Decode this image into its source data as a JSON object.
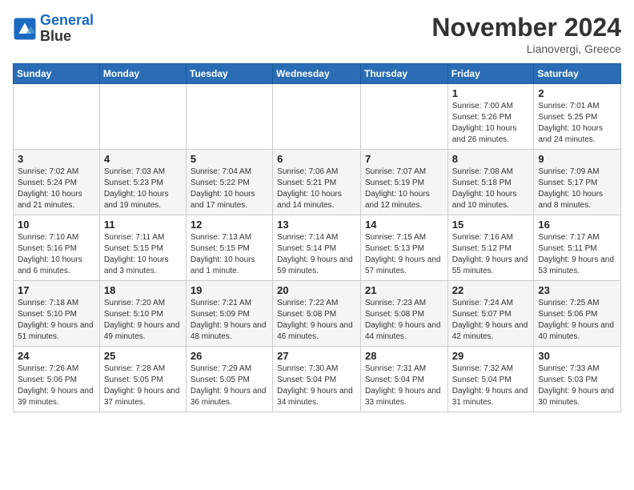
{
  "logo": {
    "line1": "General",
    "line2": "Blue"
  },
  "title": "November 2024",
  "location": "Lianovergi, Greece",
  "weekdays": [
    "Sunday",
    "Monday",
    "Tuesday",
    "Wednesday",
    "Thursday",
    "Friday",
    "Saturday"
  ],
  "weeks": [
    [
      {
        "day": "",
        "info": ""
      },
      {
        "day": "",
        "info": ""
      },
      {
        "day": "",
        "info": ""
      },
      {
        "day": "",
        "info": ""
      },
      {
        "day": "",
        "info": ""
      },
      {
        "day": "1",
        "info": "Sunrise: 7:00 AM\nSunset: 5:26 PM\nDaylight: 10 hours and 26 minutes."
      },
      {
        "day": "2",
        "info": "Sunrise: 7:01 AM\nSunset: 5:25 PM\nDaylight: 10 hours and 24 minutes."
      }
    ],
    [
      {
        "day": "3",
        "info": "Sunrise: 7:02 AM\nSunset: 5:24 PM\nDaylight: 10 hours and 21 minutes."
      },
      {
        "day": "4",
        "info": "Sunrise: 7:03 AM\nSunset: 5:23 PM\nDaylight: 10 hours and 19 minutes."
      },
      {
        "day": "5",
        "info": "Sunrise: 7:04 AM\nSunset: 5:22 PM\nDaylight: 10 hours and 17 minutes."
      },
      {
        "day": "6",
        "info": "Sunrise: 7:06 AM\nSunset: 5:21 PM\nDaylight: 10 hours and 14 minutes."
      },
      {
        "day": "7",
        "info": "Sunrise: 7:07 AM\nSunset: 5:19 PM\nDaylight: 10 hours and 12 minutes."
      },
      {
        "day": "8",
        "info": "Sunrise: 7:08 AM\nSunset: 5:18 PM\nDaylight: 10 hours and 10 minutes."
      },
      {
        "day": "9",
        "info": "Sunrise: 7:09 AM\nSunset: 5:17 PM\nDaylight: 10 hours and 8 minutes."
      }
    ],
    [
      {
        "day": "10",
        "info": "Sunrise: 7:10 AM\nSunset: 5:16 PM\nDaylight: 10 hours and 6 minutes."
      },
      {
        "day": "11",
        "info": "Sunrise: 7:11 AM\nSunset: 5:15 PM\nDaylight: 10 hours and 3 minutes."
      },
      {
        "day": "12",
        "info": "Sunrise: 7:13 AM\nSunset: 5:15 PM\nDaylight: 10 hours and 1 minute."
      },
      {
        "day": "13",
        "info": "Sunrise: 7:14 AM\nSunset: 5:14 PM\nDaylight: 9 hours and 59 minutes."
      },
      {
        "day": "14",
        "info": "Sunrise: 7:15 AM\nSunset: 5:13 PM\nDaylight: 9 hours and 57 minutes."
      },
      {
        "day": "15",
        "info": "Sunrise: 7:16 AM\nSunset: 5:12 PM\nDaylight: 9 hours and 55 minutes."
      },
      {
        "day": "16",
        "info": "Sunrise: 7:17 AM\nSunset: 5:11 PM\nDaylight: 9 hours and 53 minutes."
      }
    ],
    [
      {
        "day": "17",
        "info": "Sunrise: 7:18 AM\nSunset: 5:10 PM\nDaylight: 9 hours and 51 minutes."
      },
      {
        "day": "18",
        "info": "Sunrise: 7:20 AM\nSunset: 5:10 PM\nDaylight: 9 hours and 49 minutes."
      },
      {
        "day": "19",
        "info": "Sunrise: 7:21 AM\nSunset: 5:09 PM\nDaylight: 9 hours and 48 minutes."
      },
      {
        "day": "20",
        "info": "Sunrise: 7:22 AM\nSunset: 5:08 PM\nDaylight: 9 hours and 46 minutes."
      },
      {
        "day": "21",
        "info": "Sunrise: 7:23 AM\nSunset: 5:08 PM\nDaylight: 9 hours and 44 minutes."
      },
      {
        "day": "22",
        "info": "Sunrise: 7:24 AM\nSunset: 5:07 PM\nDaylight: 9 hours and 42 minutes."
      },
      {
        "day": "23",
        "info": "Sunrise: 7:25 AM\nSunset: 5:06 PM\nDaylight: 9 hours and 40 minutes."
      }
    ],
    [
      {
        "day": "24",
        "info": "Sunrise: 7:26 AM\nSunset: 5:06 PM\nDaylight: 9 hours and 39 minutes."
      },
      {
        "day": "25",
        "info": "Sunrise: 7:28 AM\nSunset: 5:05 PM\nDaylight: 9 hours and 37 minutes."
      },
      {
        "day": "26",
        "info": "Sunrise: 7:29 AM\nSunset: 5:05 PM\nDaylight: 9 hours and 36 minutes."
      },
      {
        "day": "27",
        "info": "Sunrise: 7:30 AM\nSunset: 5:04 PM\nDaylight: 9 hours and 34 minutes."
      },
      {
        "day": "28",
        "info": "Sunrise: 7:31 AM\nSunset: 5:04 PM\nDaylight: 9 hours and 33 minutes."
      },
      {
        "day": "29",
        "info": "Sunrise: 7:32 AM\nSunset: 5:04 PM\nDaylight: 9 hours and 31 minutes."
      },
      {
        "day": "30",
        "info": "Sunrise: 7:33 AM\nSunset: 5:03 PM\nDaylight: 9 hours and 30 minutes."
      }
    ]
  ]
}
